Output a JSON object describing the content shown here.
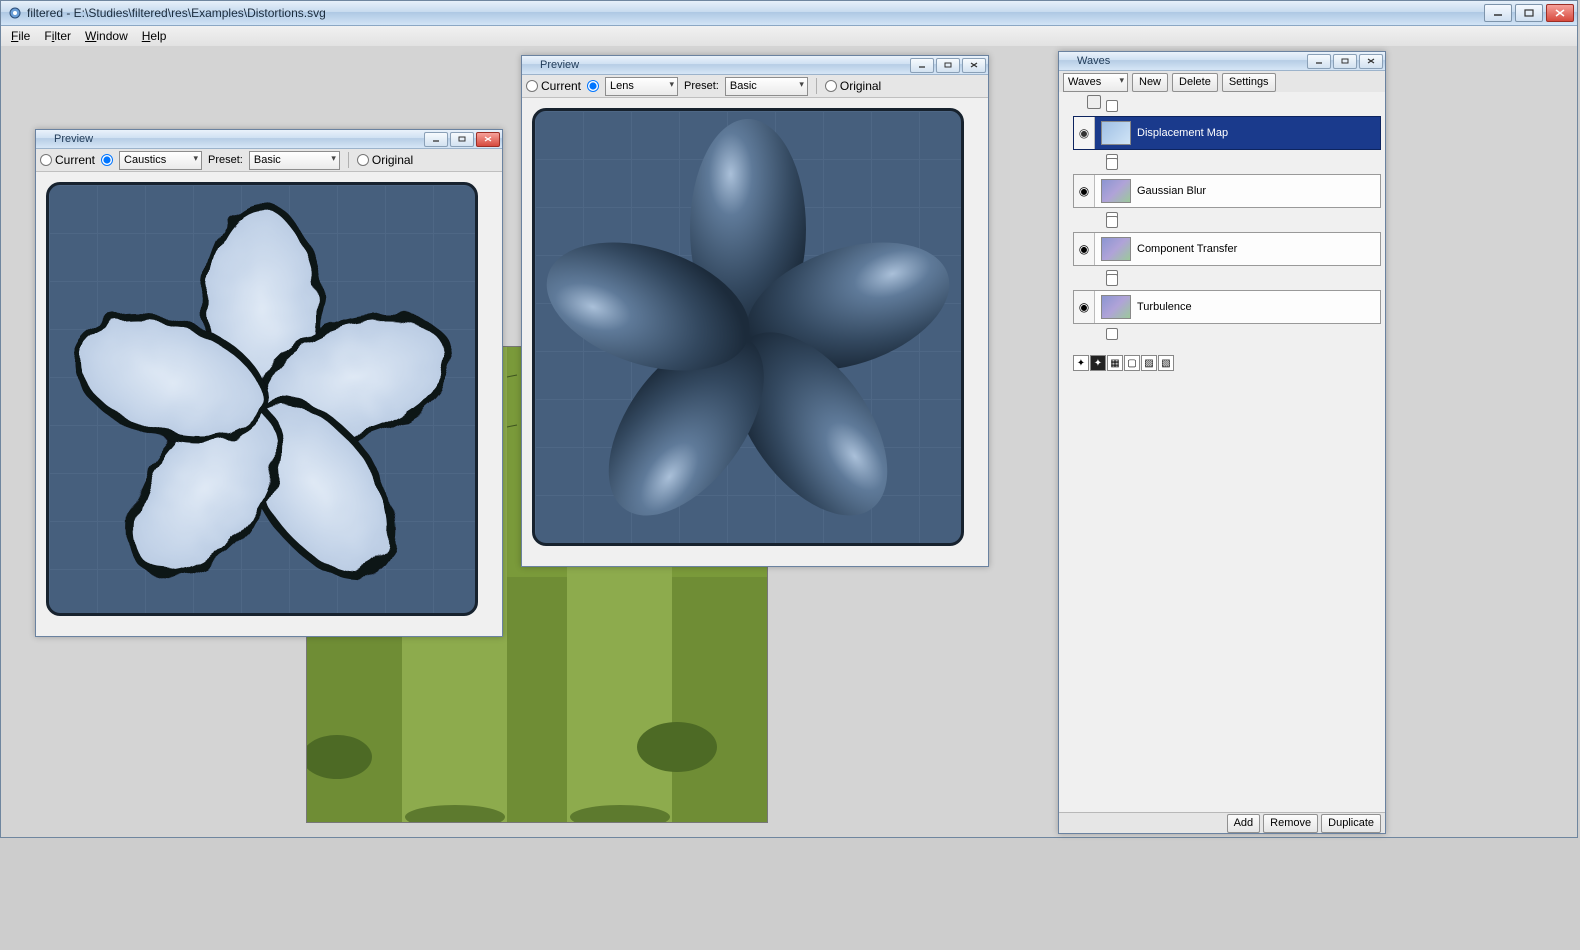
{
  "window": {
    "title": "filtered - E:\\Studies\\filtered\\res\\Examples\\Distortions.svg"
  },
  "menu": {
    "file": "File",
    "filter": "Filter",
    "window": "Window",
    "help": "Help"
  },
  "common": {
    "preview_title": "Preview",
    "current_label": "Current",
    "preset_label": "Preset:",
    "original_label": "Original"
  },
  "preview_a": {
    "mode_combo": "Caustics",
    "preset_combo": "Basic"
  },
  "preview_b": {
    "mode_combo": "Lens",
    "preset_combo": "Basic"
  },
  "waves": {
    "panel_title": "Waves",
    "filter_combo": "Waves",
    "new_btn": "New",
    "delete_btn": "Delete",
    "settings_btn": "Settings",
    "nodes": [
      {
        "label": "Displacement Map",
        "selected": true,
        "thumb_hint": "blue-white"
      },
      {
        "label": "Gaussian Blur",
        "selected": false
      },
      {
        "label": "Component Transfer",
        "selected": false
      },
      {
        "label": "Turbulence",
        "selected": false
      }
    ],
    "add_btn": "Add",
    "remove_btn": "Remove",
    "duplicate_btn": "Duplicate"
  },
  "icons": {
    "eye": "👁",
    "app": "app-icon"
  },
  "colors": {
    "accent": "#1a3a8c",
    "bg_blue": "#465f7d",
    "frame_dark": "#17222e"
  }
}
